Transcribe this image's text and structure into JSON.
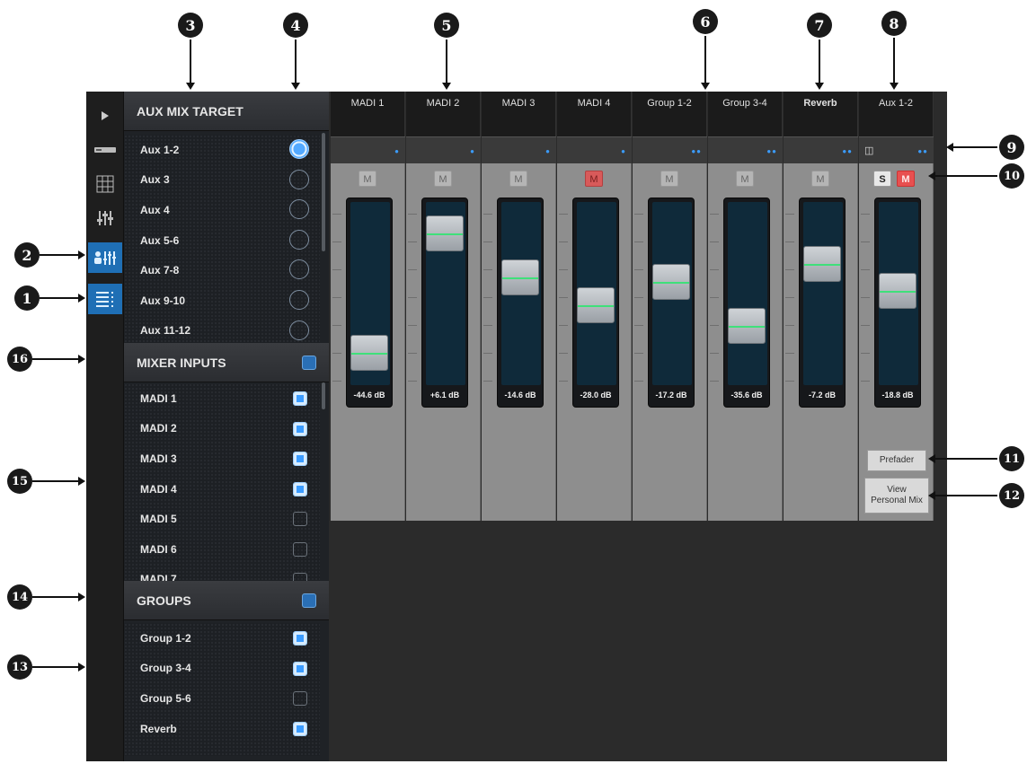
{
  "callouts": {
    "c1": "1",
    "c2": "2",
    "c3": "3",
    "c4": "4",
    "c5": "5",
    "c6": "6",
    "c7": "7",
    "c8": "8",
    "c9": "9",
    "c10": "10",
    "c11": "11",
    "c12": "12",
    "c13": "13",
    "c14": "14",
    "c15": "15",
    "c16": "16"
  },
  "aux_mix_target": {
    "header": "AUX MIX TARGET",
    "items": [
      {
        "label": "Aux 1-2",
        "selected": true
      },
      {
        "label": "Aux 3",
        "selected": false
      },
      {
        "label": "Aux 4",
        "selected": false
      },
      {
        "label": "Aux 5-6",
        "selected": false
      },
      {
        "label": "Aux 7-8",
        "selected": false
      },
      {
        "label": "Aux 9-10",
        "selected": false
      },
      {
        "label": "Aux 11-12",
        "selected": false
      }
    ]
  },
  "mixer_inputs": {
    "header": "MIXER INPUTS",
    "items": [
      {
        "label": "MADI 1",
        "checked": true
      },
      {
        "label": "MADI 2",
        "checked": true
      },
      {
        "label": "MADI 3",
        "checked": true
      },
      {
        "label": "MADI 4",
        "checked": true
      },
      {
        "label": "MADI 5",
        "checked": false
      },
      {
        "label": "MADI 6",
        "checked": false
      },
      {
        "label": "MADI 7",
        "checked": false
      }
    ]
  },
  "groups": {
    "header": "GROUPS",
    "items": [
      {
        "label": "Group 1-2",
        "checked": true
      },
      {
        "label": "Group 3-4",
        "checked": true
      },
      {
        "label": "Group 5-6",
        "checked": false
      },
      {
        "label": "Reverb",
        "checked": true
      }
    ]
  },
  "strips": [
    {
      "name": "MADI 1",
      "mute": "M",
      "muted": false,
      "value": "-44.6 dB",
      "level": 0.9
    },
    {
      "name": "MADI 2",
      "mute": "M",
      "muted": false,
      "value": "+6.1 dB",
      "level": 0.09
    },
    {
      "name": "MADI 3",
      "mute": "M",
      "muted": false,
      "value": "-14.6 dB",
      "level": 0.39
    },
    {
      "name": "MADI 4",
      "mute": "M",
      "muted": true,
      "value": "-28.0 dB",
      "level": 0.58
    },
    {
      "name": "Group 1-2",
      "mute": "M",
      "muted": false,
      "value": "-17.2 dB",
      "level": 0.42
    },
    {
      "name": "Group 3-4",
      "mute": "M",
      "muted": false,
      "value": "-35.6 dB",
      "level": 0.72
    },
    {
      "name": "Reverb",
      "mute": "M",
      "muted": false,
      "value": "-7.2 dB",
      "level": 0.3
    },
    {
      "name": "Aux 1-2",
      "solo": "S",
      "mute": "M",
      "muted": true,
      "value": "-18.8 dB",
      "level": 0.48,
      "prefader": "Prefader",
      "personal_line1": "View",
      "personal_line2": "Personal Mix"
    }
  ]
}
